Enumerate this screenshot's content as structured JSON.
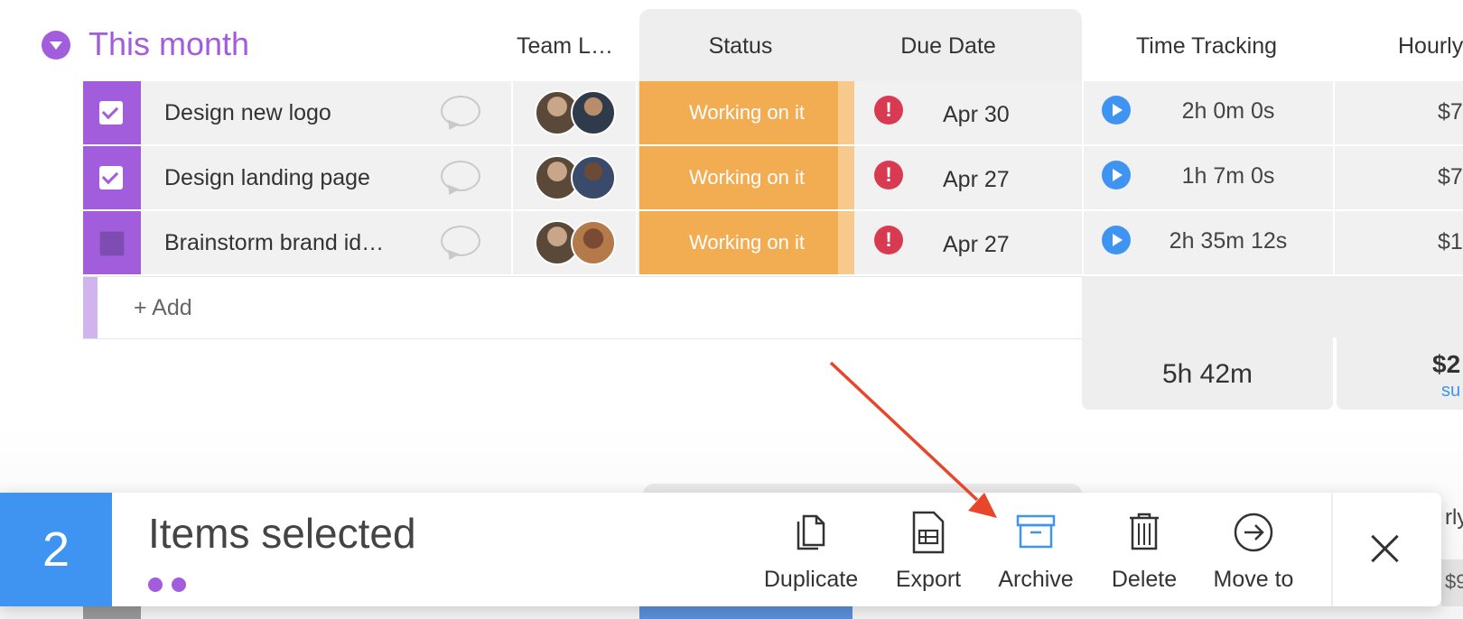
{
  "group": {
    "title": "This month"
  },
  "columns": {
    "team_lead": "Team L…",
    "status": "Status",
    "due_date": "Due Date",
    "time_tracking": "Time Tracking",
    "hourly": "Hourly"
  },
  "rows": [
    {
      "name": "Design new logo",
      "checked": true,
      "status": "Working on it",
      "due": "Apr 30",
      "time": "2h 0m 0s",
      "rate": "$7"
    },
    {
      "name": "Design landing page",
      "checked": true,
      "status": "Working on it",
      "due": "Apr 27",
      "time": "1h 7m 0s",
      "rate": "$7"
    },
    {
      "name": "Brainstorm brand id…",
      "checked": false,
      "status": "Working on it",
      "due": "Apr 27",
      "time": "2h 35m 12s",
      "rate": "$1"
    }
  ],
  "add_row": {
    "label": "+ Add"
  },
  "summary": {
    "time_total": "5h 42m",
    "money_total": "$2",
    "money_sub": "su"
  },
  "action_bar": {
    "count": "2",
    "label": "Items selected",
    "actions": [
      "Duplicate",
      "Export",
      "Archive",
      "Delete",
      "Move to"
    ]
  },
  "peek": {
    "hourly_partial": "rly",
    "value_partial": "$9"
  },
  "colors": {
    "brand_purple": "#a25ddc",
    "status_orange": "#f2ac52",
    "accent_blue": "#3e94f0",
    "alert_red": "#d83a52",
    "arrow_red": "#e8462b"
  }
}
